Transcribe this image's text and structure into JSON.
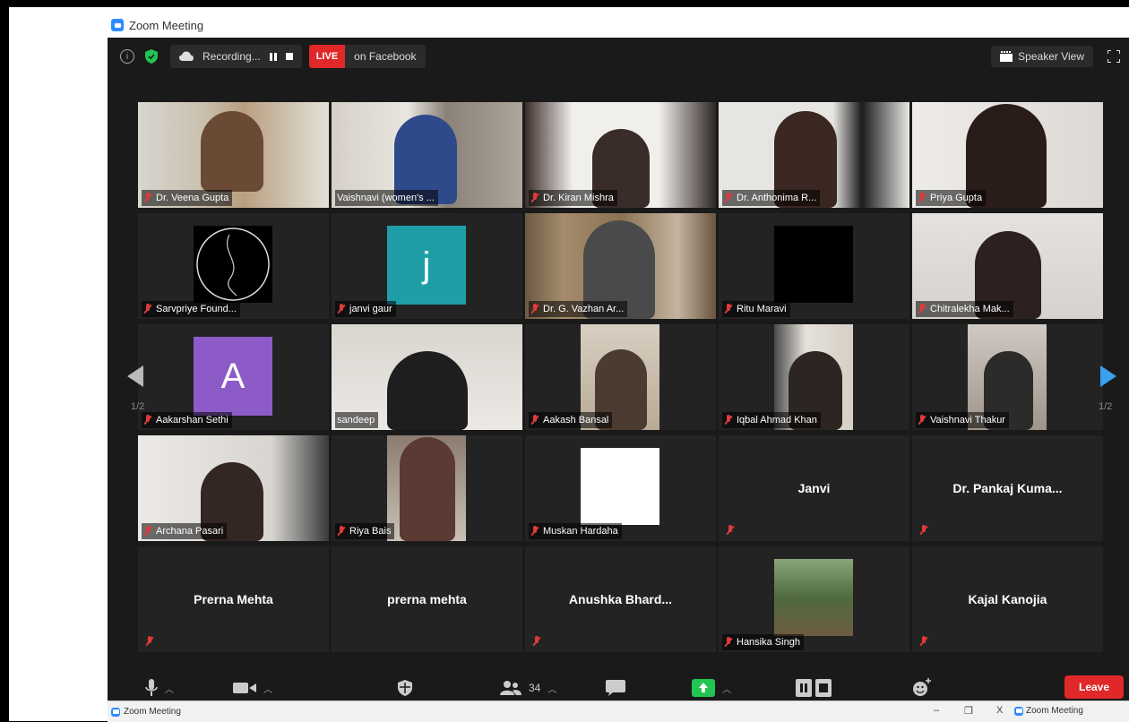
{
  "window": {
    "title": "Zoom Meeting"
  },
  "toolbar": {
    "recording_label": "Recording...",
    "live_badge": "LIVE",
    "live_destination": "on Facebook",
    "speaker_view_label": "Speaker View"
  },
  "gallery": {
    "page_left": "1/2",
    "page_right": "1/2",
    "tiles": [
      {
        "name": "Dr. Veena Gupta"
      },
      {
        "name": "Vaishnavi (women's ..."
      },
      {
        "name": "Dr. Kiran Mishra"
      },
      {
        "name": "Dr. Anthonima R..."
      },
      {
        "name": "Priya Gupta"
      },
      {
        "name": "Sarvpriye Found..."
      },
      {
        "name": "janvi gaur",
        "avatar": "j"
      },
      {
        "name": "Dr. G. Vazhan Ar..."
      },
      {
        "name": "Ritu Maravi"
      },
      {
        "name": "Chitralekha Mak..."
      },
      {
        "name": "Aakarshan Sethi",
        "avatar": "A"
      },
      {
        "name": "sandeep"
      },
      {
        "name": "Aakash Bansal"
      },
      {
        "name": "Iqbal Ahmad Khan"
      },
      {
        "name": "Vaishnavi Thakur"
      },
      {
        "name": "Archana Pasari"
      },
      {
        "name": "Riya Bais"
      },
      {
        "name": "Muskan Hardaha"
      },
      {
        "name": "Janvi"
      },
      {
        "name": "Dr. Pankaj Kuma..."
      },
      {
        "name": "Prerna Mehta"
      },
      {
        "name": "prerna mehta"
      },
      {
        "name": "Anushka  Bhard..."
      },
      {
        "name": "Hansika Singh"
      },
      {
        "name": "Kajal Kanojia"
      }
    ]
  },
  "footer": {
    "participants_count": "34",
    "leave_label": "Leave"
  },
  "taskbar": {
    "left_label": "Zoom Meeting",
    "minimize": "–",
    "restore": "❐",
    "close": "X",
    "right_label": "Zoom Meeting"
  },
  "colors": {
    "active_speaker": "#c8e04a",
    "live": "#e02828",
    "share_green": "#23c552",
    "zoom_blue": "#2d8cff",
    "janvi_avatar": "#1f9ea8",
    "aakarshan_avatar": "#8c5bc8"
  }
}
